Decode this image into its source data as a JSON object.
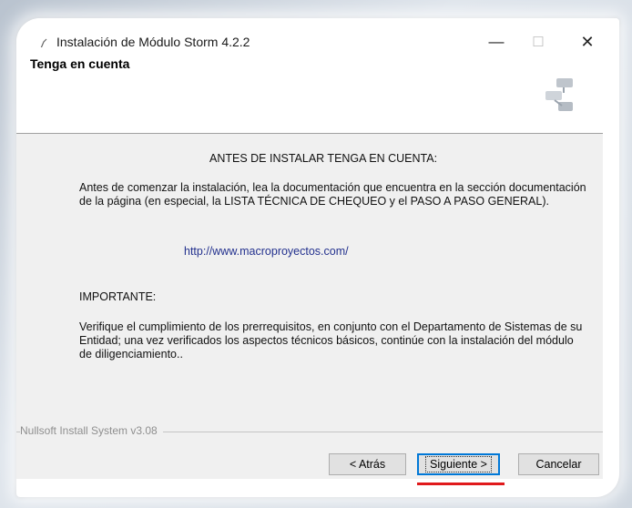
{
  "window": {
    "title": "Instalación de Módulo Storm 4.2.2",
    "controls": {
      "minimize_icon": "minimize-icon",
      "maximize_icon": "maximize-icon",
      "close_icon": "close-icon"
    }
  },
  "header": {
    "title": "Tenga en cuenta"
  },
  "content": {
    "heading": "ANTES DE INSTALAR TENGA EN CUENTA:",
    "paragraph1": "Antes de comenzar la instalación, lea la documentación que encuentra en la sección documentación de la página (en especial, la LISTA TÉCNICA DE CHEQUEO y el PASO A PASO GENERAL).",
    "link": "http://www.macroproyectos.com/",
    "important": "IMPORTANTE:",
    "paragraph2": "Verifique el cumplimiento de los prerrequisitos, en conjunto con el Departamento de Sistemas de su Entidad; una vez verificados los aspectos técnicos básicos, continúe con la instalación del módulo de diligenciamiento.."
  },
  "footer": {
    "branding": "Nullsoft Install System v3.08",
    "buttons": {
      "back": "< Atrás",
      "next": "Siguiente >",
      "cancel": "Cancelar"
    }
  },
  "colors": {
    "link": "#23318e",
    "focus_border": "#0078d7",
    "highlight_underline": "#e0191b"
  }
}
